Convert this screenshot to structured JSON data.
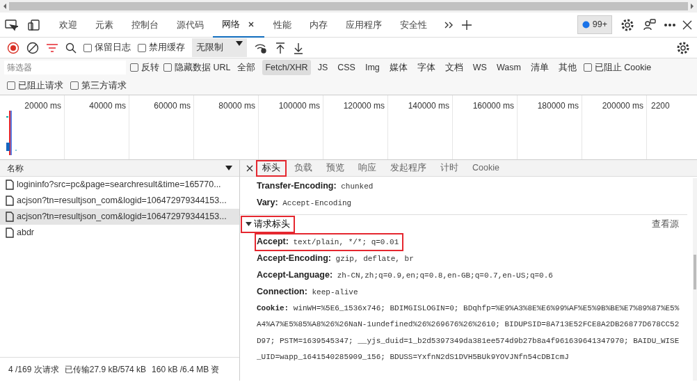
{
  "panel_tabs": [
    {
      "label": "欢迎",
      "selected": false,
      "closable": false
    },
    {
      "label": "元素",
      "selected": false,
      "closable": false
    },
    {
      "label": "控制台",
      "selected": false,
      "closable": false
    },
    {
      "label": "源代码",
      "selected": false,
      "closable": false
    },
    {
      "label": "网络",
      "selected": true,
      "closable": true
    },
    {
      "label": "性能",
      "selected": false,
      "closable": false
    },
    {
      "label": "内存",
      "selected": false,
      "closable": false
    },
    {
      "label": "应用程序",
      "selected": false,
      "closable": false
    },
    {
      "label": "安全性",
      "selected": false,
      "closable": false
    }
  ],
  "issues_badge": "99+",
  "toolbar": {
    "recording": true,
    "checkboxes": [
      {
        "label": "保留日志",
        "checked": false
      },
      {
        "label": "禁用缓存",
        "checked": false
      }
    ],
    "throttling": "无限制"
  },
  "filter": {
    "placeholder": "筛选器",
    "checkboxes": [
      {
        "label": "反转",
        "checked": false
      },
      {
        "label": "隐藏数据 URL",
        "checked": false
      }
    ],
    "types": [
      {
        "label": "全部",
        "selected": false
      },
      {
        "label": "Fetch/XHR",
        "selected": true
      },
      {
        "label": "JS",
        "selected": false
      },
      {
        "label": "CSS",
        "selected": false
      },
      {
        "label": "Img",
        "selected": false
      },
      {
        "label": "媒体",
        "selected": false
      },
      {
        "label": "字体",
        "selected": false
      },
      {
        "label": "文档",
        "selected": false
      },
      {
        "label": "WS",
        "selected": false
      },
      {
        "label": "Wasm",
        "selected": false
      },
      {
        "label": "清单",
        "selected": false
      },
      {
        "label": "其他",
        "selected": false
      }
    ],
    "more_checkboxes": [
      {
        "label": "已阻止 Cookie",
        "checked": false
      },
      {
        "label": "已阻止请求",
        "checked": false
      },
      {
        "label": "第三方请求",
        "checked": false
      }
    ]
  },
  "overview": {
    "ticks": [
      "20000 ms",
      "40000 ms",
      "60000 ms",
      "80000 ms",
      "100000 ms",
      "120000 ms",
      "140000 ms",
      "160000 ms",
      "180000 ms",
      "200000 ms",
      "2200"
    ]
  },
  "requests": {
    "column": "名称",
    "rows": [
      {
        "name": "logininfo?src=pc&page=searchresult&time=165770...",
        "selected": false
      },
      {
        "name": "acjson?tn=resultjson_com&logid=106472979344153...",
        "selected": false
      },
      {
        "name": "acjson?tn=resultjson_com&logid=106472979344153...",
        "selected": true
      },
      {
        "name": "abdr",
        "selected": false
      }
    ]
  },
  "status_bar": [
    "4 /169 次请求",
    "已传输27.9 kB/574 kB",
    "160 kB /6.4 MB 资"
  ],
  "details": {
    "tabs": [
      {
        "label": "标头",
        "selected": true,
        "highlighted": true
      },
      {
        "label": "负载",
        "selected": false,
        "highlighted": false
      },
      {
        "label": "预览",
        "selected": false,
        "highlighted": false
      },
      {
        "label": "响应",
        "selected": false,
        "highlighted": false
      },
      {
        "label": "发起程序",
        "selected": false,
        "highlighted": false
      },
      {
        "label": "计时",
        "selected": false,
        "highlighted": false
      },
      {
        "label": "Cookie",
        "selected": false,
        "highlighted": false
      }
    ],
    "response_headers": [
      {
        "name": "Transfer-Encoding:",
        "value": "chunked",
        "highlighted": false
      },
      {
        "name": "Vary:",
        "value": "Accept-Encoding",
        "highlighted": false
      }
    ],
    "request_section": {
      "title": "请求标头",
      "expanded": true,
      "highlighted": true,
      "view_source": "查看源"
    },
    "request_headers": [
      {
        "name": "Accept:",
        "value": "text/plain, */*; q=0.01",
        "highlighted": true
      },
      {
        "name": "Accept-Encoding:",
        "value": "gzip, deflate, br",
        "highlighted": false
      },
      {
        "name": "Accept-Language:",
        "value": "zh-CN,zh;q=0.9,en;q=0.8,en-GB;q=0.7,en-US;q=0.6",
        "highlighted": false
      },
      {
        "name": "Connection:",
        "value": "keep-alive",
        "highlighted": false
      },
      {
        "name": "Cookie:",
        "value": "winWH=%5E6_1536x746; BDIMGISLOGIN=0; BDqhfp=%E9%A3%8E%E6%99%AF%E5%9B%BE%E7%89%87%E5%A4%A7%E5%85%A8%26%26NaN-1undefined%26%269676%26%2610; BIDUPSID=8A713E52FCE8A2DB26877D678CC52D97; PSTM=1639545347; __yjs_duid=1_b2d5397349da381ee574d9b27b8a4f961639641347970; BAIDU_WISE_UID=wapp_1641540285909_156; BDUSS=YxfnN2dS1DVH5BUk9YOVJNfn54cDBIcmJ",
        "highlighted": false
      }
    ]
  }
}
